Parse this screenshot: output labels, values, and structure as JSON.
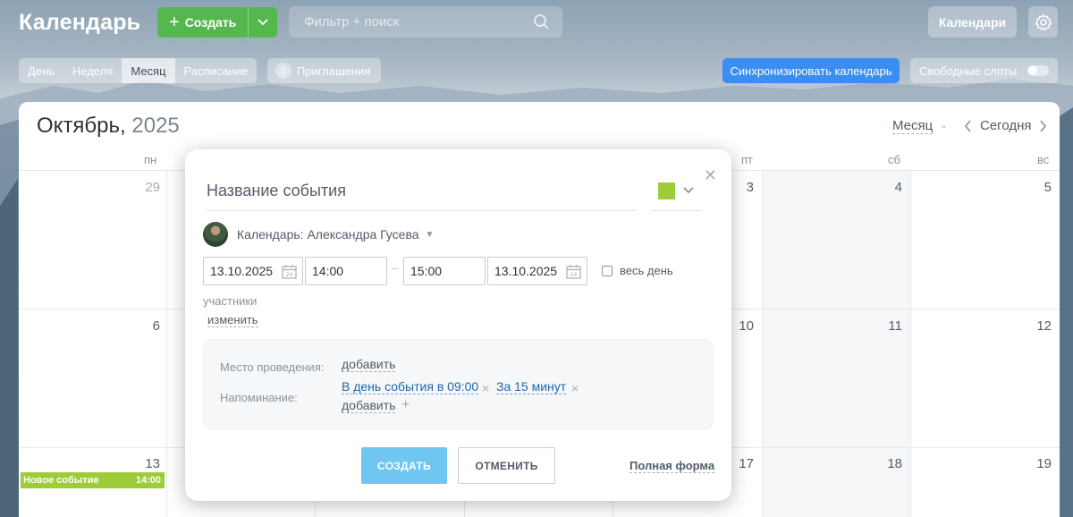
{
  "header": {
    "app_title": "Календарь",
    "create_label": "Создать",
    "search_placeholder": "Фильтр + поиск",
    "calendars_label": "Календари"
  },
  "toolbar": {
    "view_tabs": [
      "День",
      "Неделя",
      "Месяц",
      "Расписание"
    ],
    "active_view": "Месяц",
    "invites_count": "0",
    "invites_label": "Приглашения",
    "sync_label": "Синхронизировать календарь",
    "free_slots_label": "Свободные слоты"
  },
  "calendar": {
    "month": "Октябрь,",
    "year": "2025",
    "view_select": "Месяц",
    "today_label": "Сегодня",
    "weekdays": [
      "пн",
      "пт",
      "сб",
      "вс"
    ],
    "days": {
      "d29": "29",
      "d3": "3",
      "d4": "4",
      "d5": "5",
      "d6": "6",
      "d10": "10",
      "d11": "11",
      "d12": "12",
      "d13": "13",
      "d17": "17",
      "d18": "18",
      "d19": "19"
    },
    "event": {
      "title": "Новое событие",
      "time": "14:00",
      "color": "#9dcc3b"
    }
  },
  "popup": {
    "event_name_placeholder": "Название события",
    "event_color": "#9dcc3b",
    "owner_label": "Календарь: Александра Гусева",
    "date_from": "13.10.2025",
    "time_from": "14:00",
    "time_to": "15:00",
    "date_to": "13.10.2025",
    "dash": "–",
    "all_day_label": "весь день",
    "participants_label": "участники",
    "change_label": "изменить",
    "location_label": "Место проведения:",
    "location_add": "добавить",
    "reminder_label": "Напоминание:",
    "reminder_1": "В день события в 09:00",
    "reminder_2": "За 15 минут",
    "reminder_add": "добавить",
    "create_button": "СОЗДАТЬ",
    "cancel_button": "ОТМЕНИТЬ",
    "full_form_link": "Полная форма"
  },
  "colors": {
    "create_green": "#55b84e",
    "sync_blue": "#3b8ef1",
    "event_green": "#9dcc3b",
    "popup_create": "#6fc6f0"
  }
}
